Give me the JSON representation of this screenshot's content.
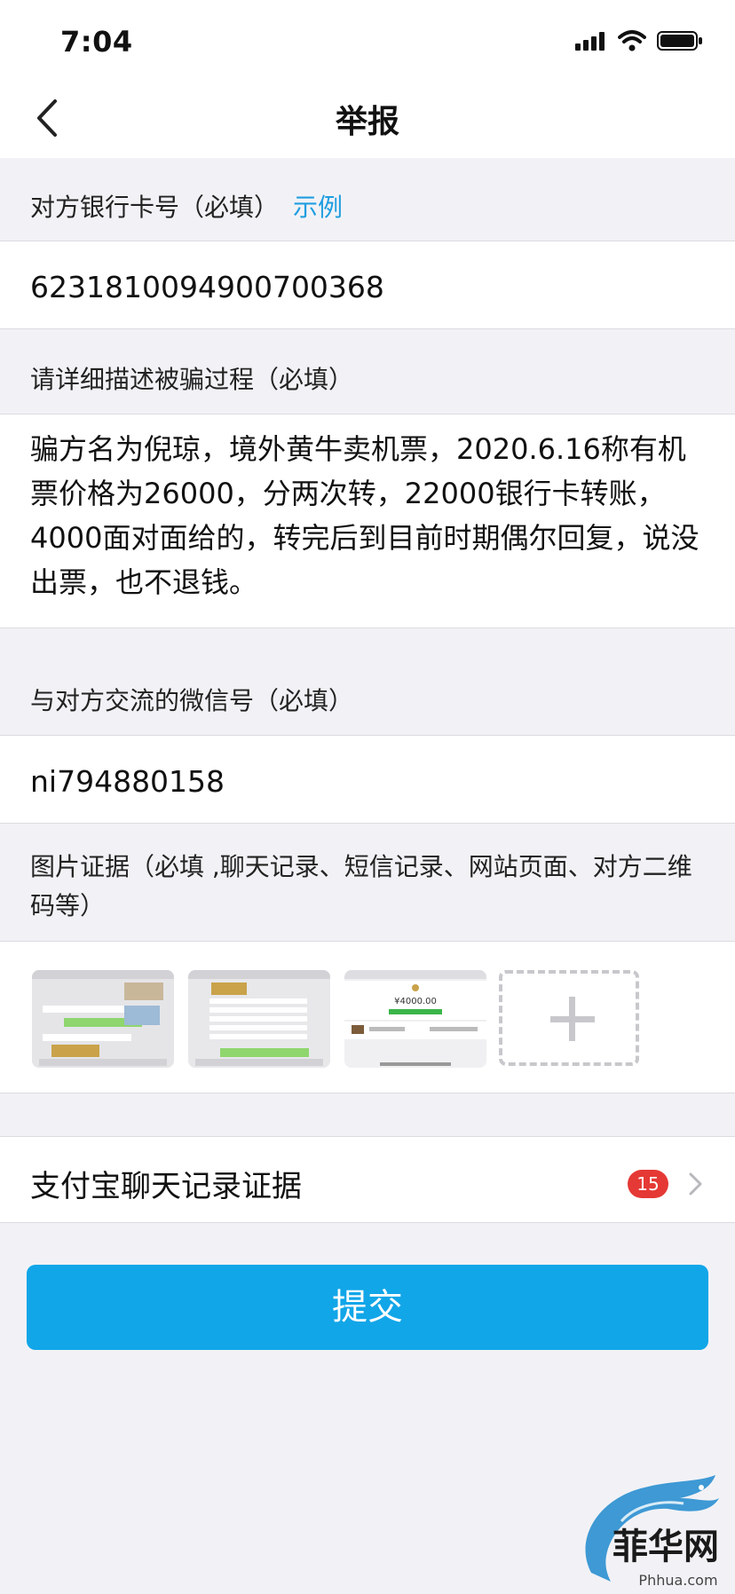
{
  "status_bar": {
    "time": "7:04"
  },
  "nav": {
    "title": "举报"
  },
  "bank_card": {
    "label": "对方银行卡号（必填）",
    "example_link": "示例",
    "value": "6231810094900700368"
  },
  "description": {
    "label": "请详细描述被骗过程（必填）",
    "value": "骗方名为倪琼，境外黄牛卖机票，2020.6.16称有机票价格为26000，分两次转，22000银行卡转账，4000面对面给的，转完后到目前时期偶尔回复，说没出票，也不退钱。"
  },
  "wechat": {
    "label": "与对方交流的微信号（必填）",
    "value": "ni794880158"
  },
  "evidence": {
    "label": "图片证据（必填 ,聊天记录、短信记录、网站页面、对方二维码等）",
    "thumb3_amount": "¥4000.00"
  },
  "alipay": {
    "label": "支付宝聊天记录证据",
    "badge": "15"
  },
  "submit": {
    "label": "提交"
  },
  "watermark": {
    "text": "菲华网",
    "domain": "Phhua.com"
  },
  "colors": {
    "accent": "#11a6e8",
    "link": "#1f9ee0",
    "badge": "#e53935",
    "background": "#f2f2f6"
  }
}
